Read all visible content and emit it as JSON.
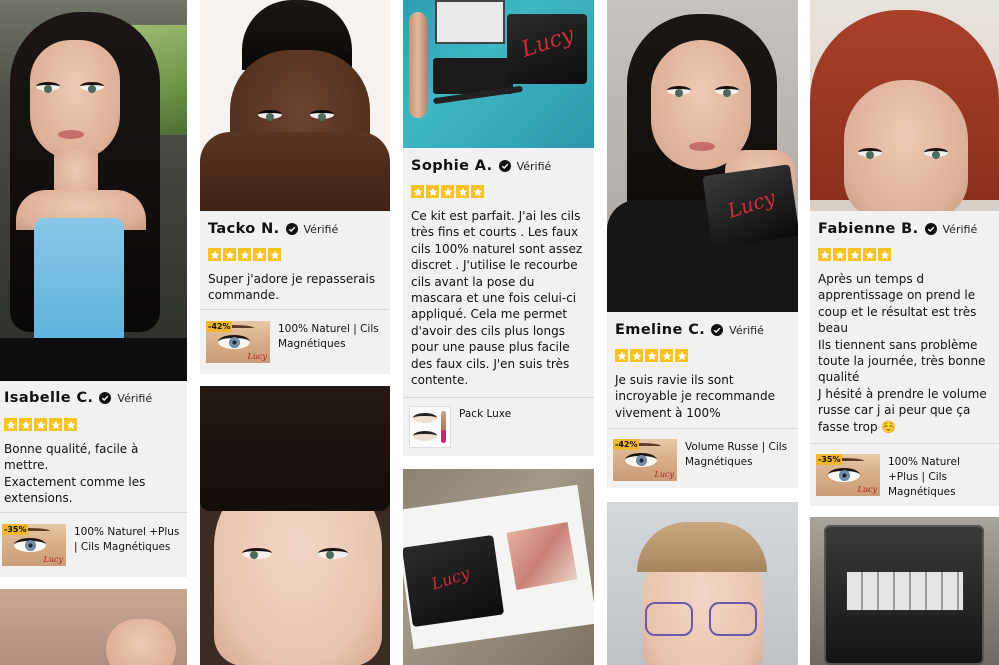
{
  "colors": {
    "star": "#f5c324",
    "card_bg": "#f1f1f1",
    "logo_red": "#cf2c38",
    "discount_badge": "#f2b630"
  },
  "verified_label": "Vérifié",
  "reviews": [
    {
      "name": "Isabelle C.",
      "rating": 5,
      "text": "Bonne qualité, facile à mettre.\nExactement comme les extensions.",
      "product": {
        "badge": "-35%",
        "label": "100% Naturel +Plus | Cils Magnétiques"
      }
    },
    {
      "name": "Tacko N.",
      "rating": 5,
      "text": "Super j'adore je repasserais commande.",
      "product": {
        "badge": "-42%",
        "label": "100% Naturel | Cils Magnétiques"
      }
    },
    {
      "name": "Sophie A.",
      "rating": 5,
      "text": "Ce kit est parfait. J'ai les cils très fins  et courts . Les faux cils 100% naturel sont assez discret . J'utilise le recourbe cils avant la pose du mascara et une fois celui-ci appliqué. Cela me permet d'avoir des cils plus longs pour une pause plus facile des faux cils. J'en suis très contente.",
      "product": {
        "badge": "",
        "label": "Pack Luxe"
      }
    },
    {
      "name": "Emeline C.",
      "rating": 5,
      "text": "Je suis ravie ils sont incroyable je recommande vivement à 100%",
      "product": {
        "badge": "-42%",
        "label": "Volume Russe | Cils Magnétiques"
      }
    },
    {
      "name": "Fabienne B.",
      "rating": 5,
      "text": "Après un temps d apprentissage on prend le coup et le résultat est très beau\nIls tiennent sans problème toute la journée, très bonne qualité\nJ hésité à prendre le volume russe car j ai peur que ça fasse trop ☺️",
      "product": {
        "badge": "-35%",
        "label": "100% Naturel +Plus | Cils Magnétiques"
      }
    }
  ],
  "brand_logo": "Lucy"
}
